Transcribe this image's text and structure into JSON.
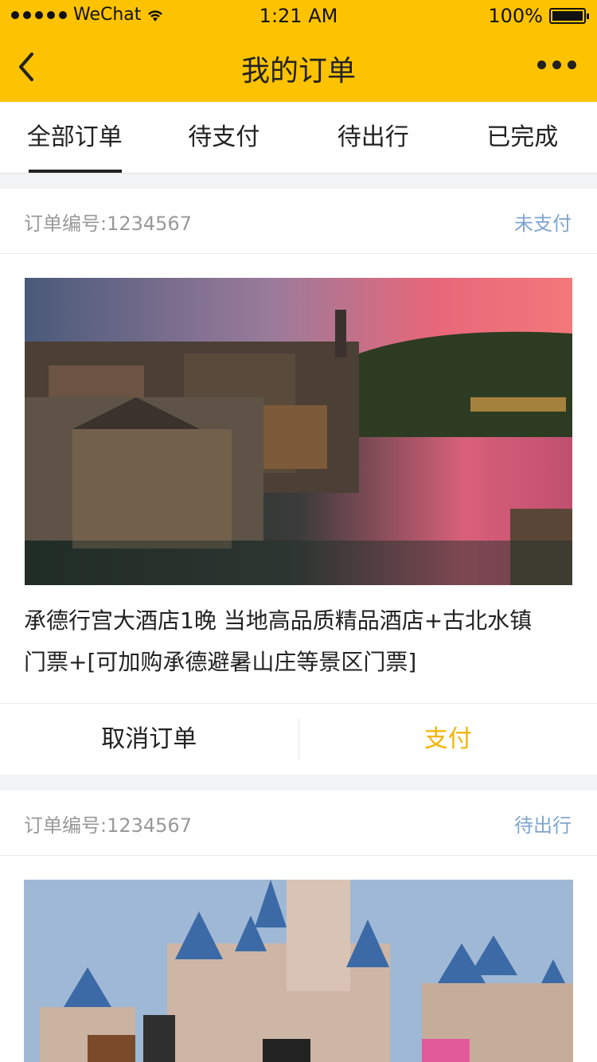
{
  "status_bar": {
    "carrier": "WeChat",
    "time": "1:21 AM",
    "battery": "100%"
  },
  "navbar": {
    "title": "我的订单",
    "back_icon": "chevron-left-icon",
    "more_icon": "more-dots-icon"
  },
  "tabs": [
    {
      "label": "全部订单",
      "active": true
    },
    {
      "label": "待支付",
      "active": false
    },
    {
      "label": "待出行",
      "active": false
    },
    {
      "label": "已完成",
      "active": false
    }
  ],
  "orders": [
    {
      "order_number": "订单编号:1234567",
      "status": "未支付",
      "image": "Ancient water town at dusk with lit buildings and reflective canal",
      "title_line1": "承德行宫大酒店1晚   当地高品质精品酒店+古北水镇",
      "title_line2": "门票+[可加购承德避暑山庄等景区门票]",
      "actions": {
        "cancel": "取消订单",
        "pay": "支付"
      }
    },
    {
      "order_number": "订单编号:1234567",
      "status": "待出行",
      "image": "Fairy-tale castle with blue spires and cartoon characters"
    }
  ],
  "colors": {
    "brand": "#fec300",
    "pay": "#f3b400",
    "status_link": "#7fa5cf"
  }
}
